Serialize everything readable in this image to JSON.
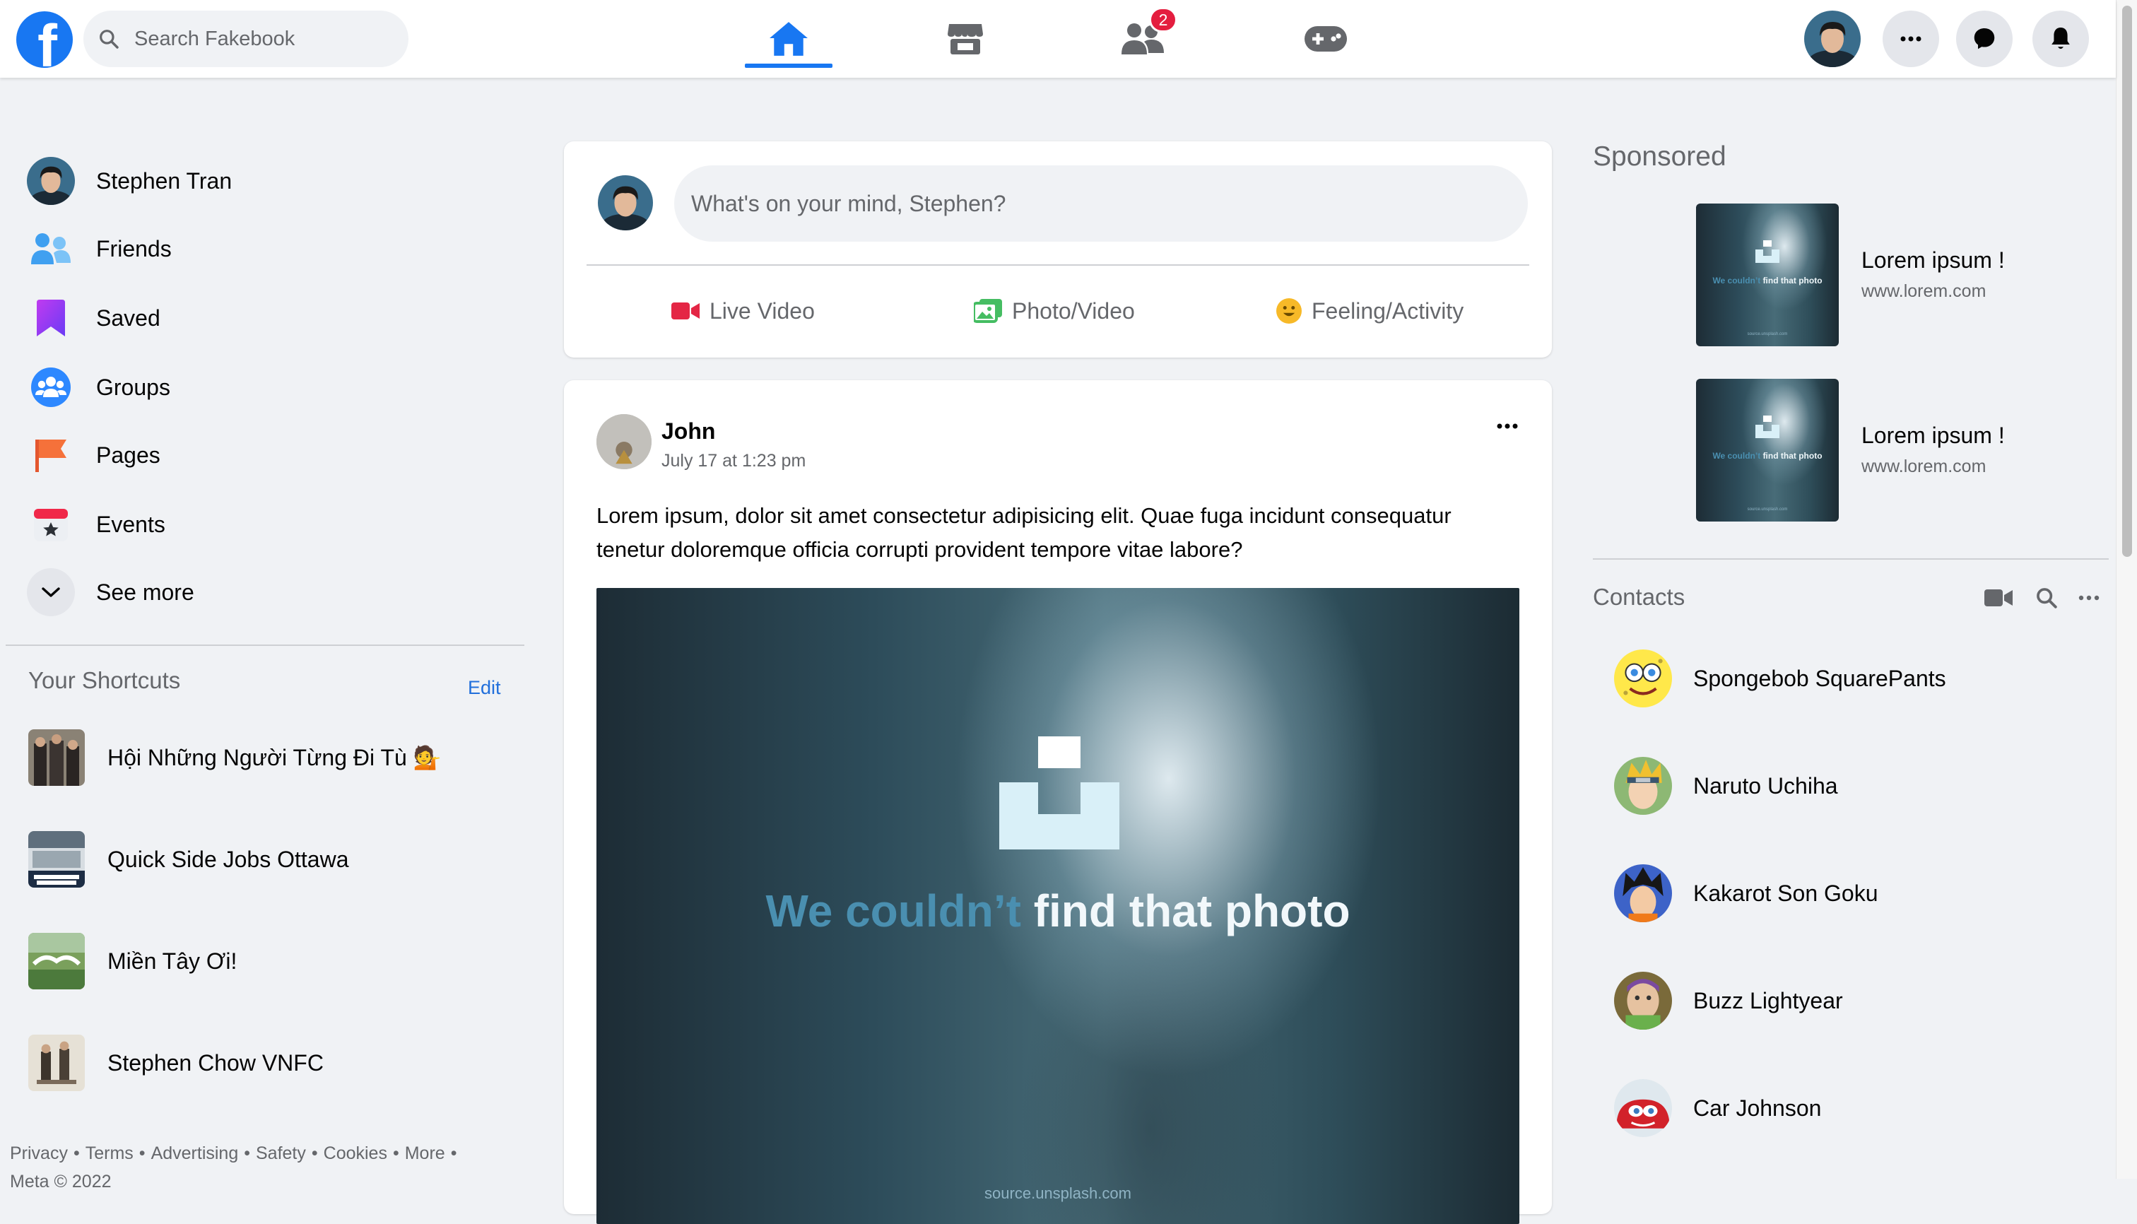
{
  "topbar": {
    "logo_letter": "f",
    "search_placeholder": "Search Fakebook",
    "tabs": [
      {
        "name": "home",
        "icon": "home-icon",
        "active": true
      },
      {
        "name": "marketplace",
        "icon": "store-icon",
        "active": false
      },
      {
        "name": "friends",
        "icon": "people-icon",
        "active": false,
        "badge": "2"
      },
      {
        "name": "gaming",
        "icon": "gamepad-icon",
        "active": false
      }
    ],
    "right_icons": [
      "avatar",
      "more-icon",
      "messenger-icon",
      "bell-icon"
    ]
  },
  "left_sidebar": {
    "items": [
      {
        "label": "Stephen Tran",
        "icon": "avatar"
      },
      {
        "label": "Friends",
        "icon": "friends-icon"
      },
      {
        "label": "Saved",
        "icon": "bookmark-icon"
      },
      {
        "label": "Groups",
        "icon": "groups-icon"
      },
      {
        "label": "Pages",
        "icon": "flag-icon"
      },
      {
        "label": "Events",
        "icon": "calendar-icon"
      },
      {
        "label": "See more",
        "icon": "chevron-down-icon"
      }
    ],
    "shortcuts_title": "Your Shortcuts",
    "edit_label": "Edit",
    "shortcuts": [
      {
        "label": "Hội Những Người Từng Đi Tù 💁"
      },
      {
        "label": "Quick Side Jobs Ottawa"
      },
      {
        "label": "Miền Tây Ơi!"
      },
      {
        "label": "Stephen Chow VNFC"
      }
    ],
    "footer": [
      "Privacy",
      "Terms",
      "Advertising",
      "Safety",
      "Cookies",
      "More"
    ],
    "footer_partial": "Meta © 2022"
  },
  "composer": {
    "placeholder": "What's on your mind, Stephen?",
    "actions": [
      {
        "label": "Live Video",
        "icon": "video-icon",
        "color": "#e42645"
      },
      {
        "label": "Photo/Video",
        "icon": "photo-icon",
        "color": "#45bd62"
      },
      {
        "label": "Feeling/Activity",
        "icon": "smile-icon",
        "color": "#f7b928"
      }
    ]
  },
  "post": {
    "author": "John",
    "timestamp": "July 17 at 1:23 pm",
    "text": "Lorem ipsum, dolor sit amet consectetur adipisicing elit. Quae fuga incidunt consequatur tenetur doloremque officia corrupti provident tempore vitae labore?",
    "photo": {
      "message_part1": "We couldn’t",
      "message_part2": "find that photo",
      "source": "source.unsplash.com"
    }
  },
  "right_sidebar": {
    "sponsored_title": "Sponsored",
    "ads": [
      {
        "title": "Lorem ipsum !",
        "url": "www.lorem.com"
      },
      {
        "title": "Lorem ipsum !",
        "url": "www.lorem.com"
      }
    ],
    "contacts_title": "Contacts",
    "contacts": [
      {
        "name": "Spongebob SquarePants"
      },
      {
        "name": "Naruto Uchiha"
      },
      {
        "name": "Kakarot Son Goku"
      },
      {
        "name": "Buzz Lightyear"
      },
      {
        "name": "Car Johnson"
      }
    ]
  },
  "colors": {
    "brand": "#1877f2",
    "background": "#f0f2f5",
    "secondary_text": "#65676b",
    "badge": "#e41e3f"
  }
}
